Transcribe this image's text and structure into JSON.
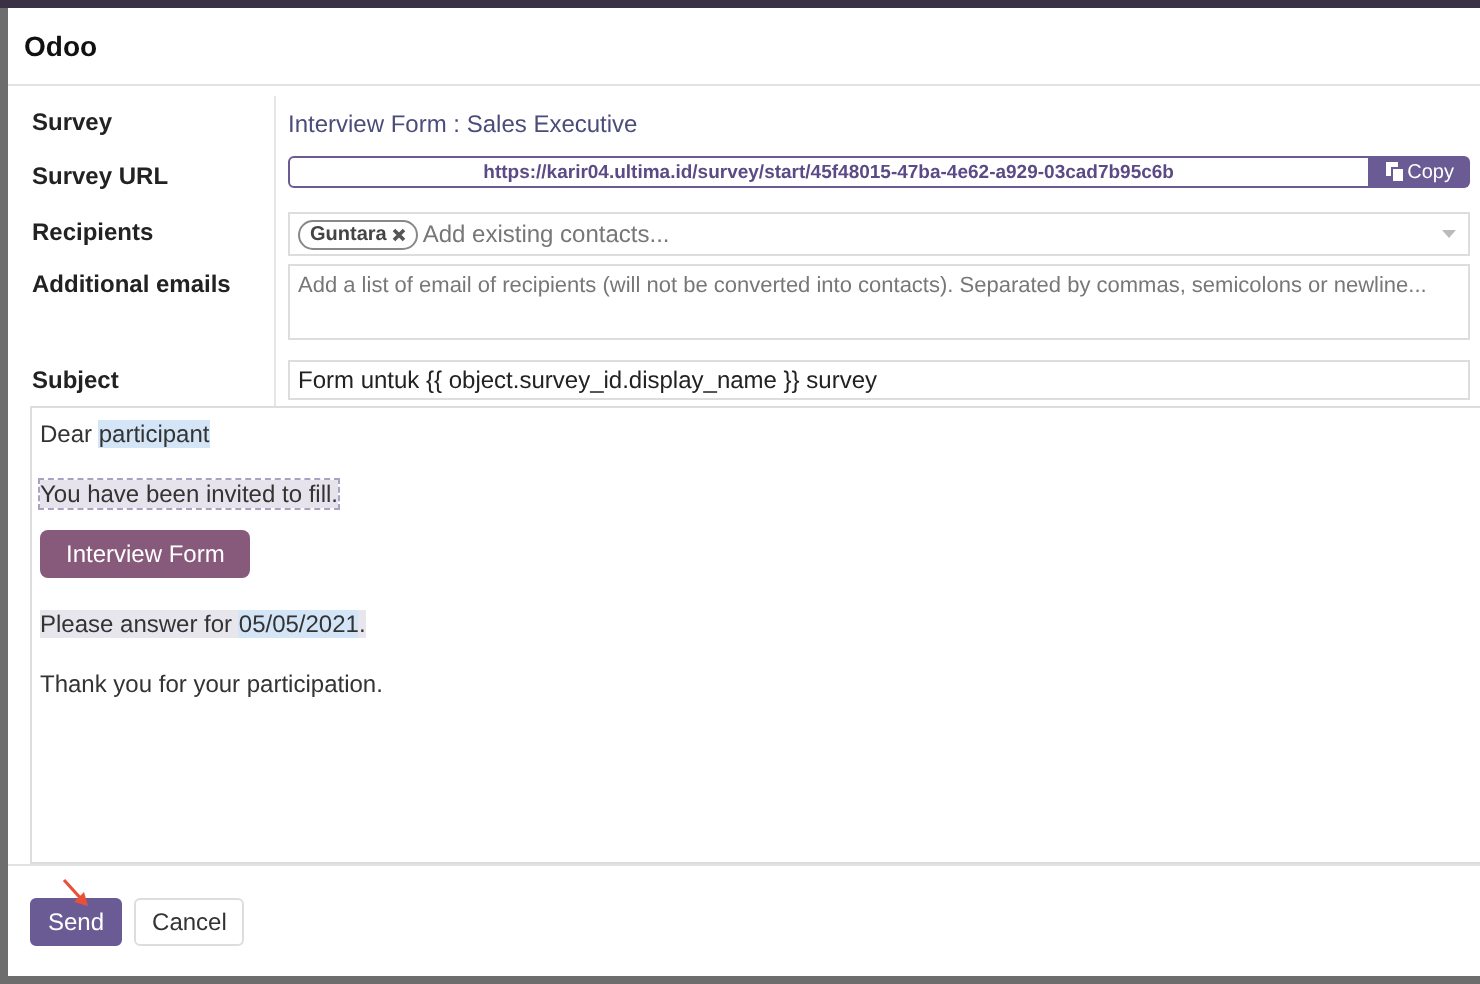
{
  "dialog": {
    "title": "Odoo"
  },
  "fields": [
    {
      "label": "Survey",
      "kind": "text",
      "value": "Interview Form : Sales Executive"
    },
    {
      "label": "Survey URL",
      "kind": "url",
      "value": "https://karir04.ultima.id/survey/start/45f48015-47ba-4e62-a929-03cad7b95c6b",
      "button": "Copy"
    },
    {
      "label": "Recipients",
      "kind": "tags",
      "tags": [
        "Guntara"
      ],
      "placeholder": "Add existing contacts..."
    },
    {
      "label": "Additional emails",
      "kind": "textarea",
      "placeholder": "Add a list of email of recipients (will not be converted into contacts). Separated by commas, semicolons or newline..."
    },
    {
      "label": "Subject",
      "kind": "input",
      "value": "Form untuk {{ object.survey_id.display_name }} survey"
    }
  ],
  "body": [
    {
      "kind": "paragraph",
      "segments": [
        {
          "text": "Dear ",
          "kind": "plain"
        },
        {
          "text": "participant",
          "kind": "placeholder"
        }
      ]
    },
    {
      "kind": "paragraph",
      "segments": [
        {
          "text": "You have been invited to fill.",
          "kind": "dashed"
        }
      ]
    },
    {
      "kind": "button",
      "label": "Interview Form"
    },
    {
      "kind": "paragraph",
      "segments": [
        {
          "text": "Please answer for ",
          "kind": "shaded"
        },
        {
          "text": "05/05/2021",
          "kind": "placeholder"
        },
        {
          "text": ".",
          "kind": "shaded"
        }
      ]
    },
    {
      "kind": "paragraph",
      "segments": [
        {
          "text": "Thank you for your participation.",
          "kind": "plain"
        }
      ]
    }
  ],
  "buttons": [
    {
      "label": "Send",
      "primary": true
    },
    {
      "label": "Cancel",
      "primary": false
    }
  ]
}
